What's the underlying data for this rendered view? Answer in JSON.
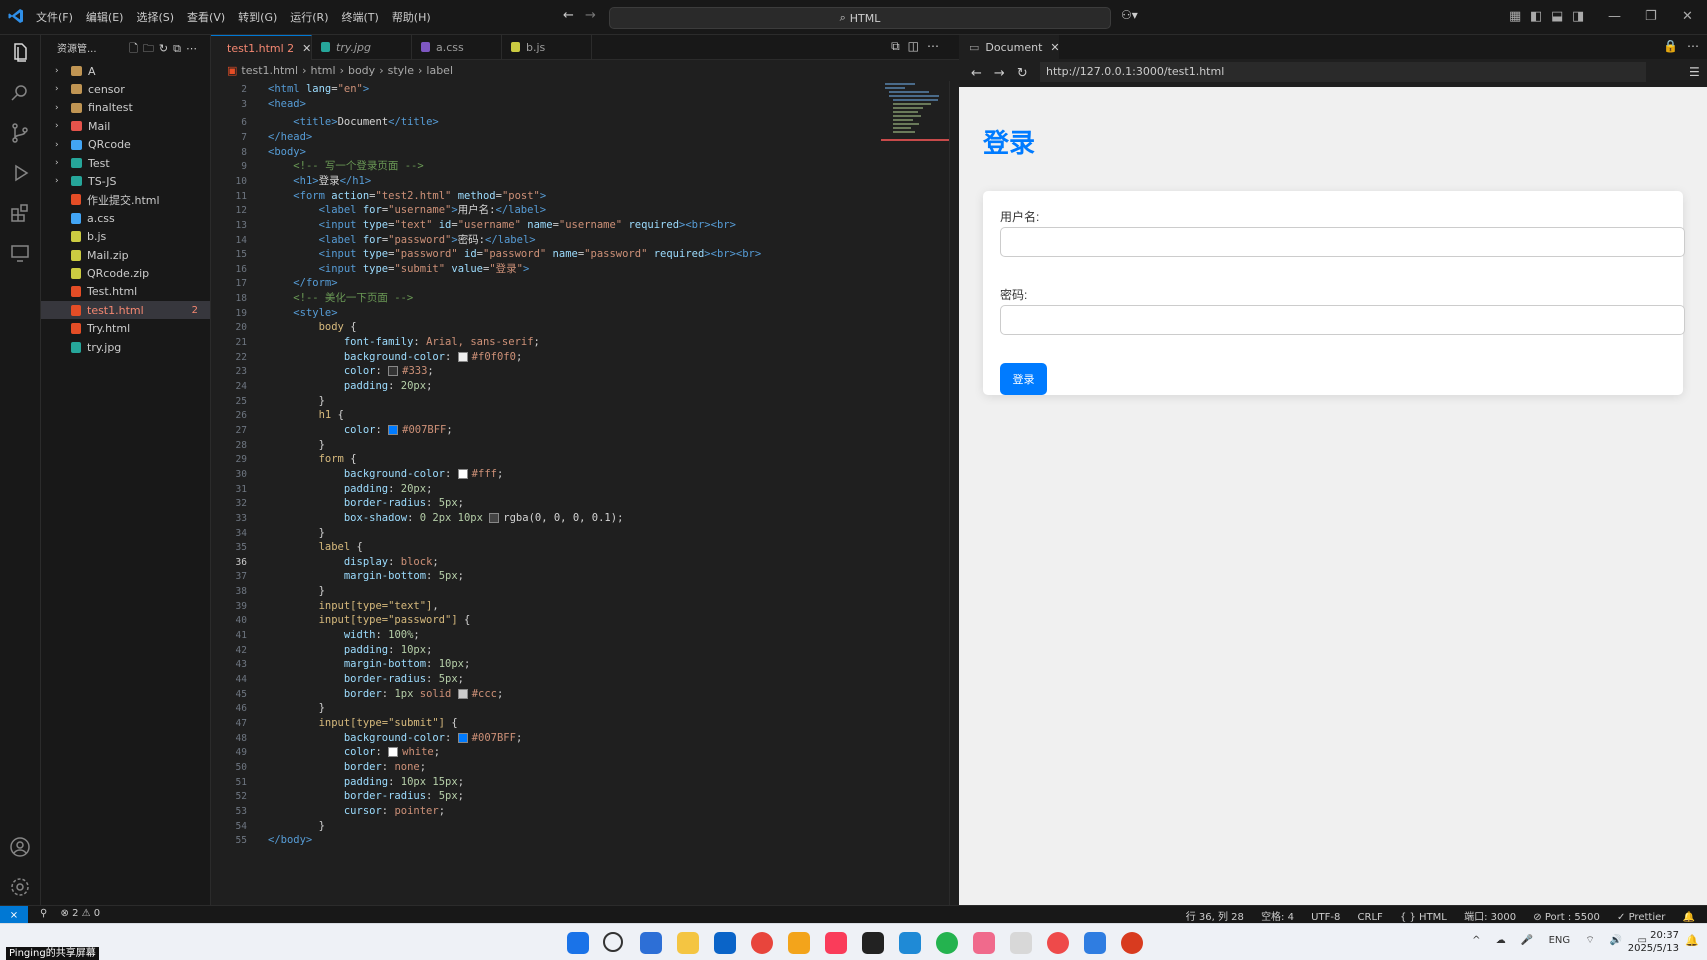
{
  "menu": [
    "文件(F)",
    "编辑(E)",
    "选择(S)",
    "查看(V)",
    "转到(G)",
    "运行(R)",
    "终端(T)",
    "帮助(H)"
  ],
  "command_center": "HTML",
  "explorer": {
    "title": "资源管...",
    "items": [
      {
        "label": "A",
        "type": "folder",
        "color": "#c09553"
      },
      {
        "label": "censor",
        "type": "folder",
        "color": "#c09553"
      },
      {
        "label": "finaltest",
        "type": "folder",
        "color": "#c09553"
      },
      {
        "label": "Mail",
        "type": "folder",
        "color": "#e5534b"
      },
      {
        "label": "QRcode",
        "type": "folder",
        "color": "#42a5f5"
      },
      {
        "label": "Test",
        "type": "folder",
        "color": "#26a69a"
      },
      {
        "label": "TS-JS",
        "type": "folder",
        "color": "#26a69a"
      },
      {
        "label": "作业提交.html",
        "type": "file",
        "color": "#e44d26"
      },
      {
        "label": "a.css",
        "type": "file",
        "color": "#42a5f5"
      },
      {
        "label": "b.js",
        "type": "file",
        "color": "#cbcb41"
      },
      {
        "label": "Mail.zip",
        "type": "file",
        "color": "#cbcb41"
      },
      {
        "label": "QRcode.zip",
        "type": "file",
        "color": "#cbcb41"
      },
      {
        "label": "Test.html",
        "type": "file",
        "color": "#e44d26"
      },
      {
        "label": "test1.html",
        "type": "file",
        "color": "#e44d26",
        "selected": true,
        "badge": "2"
      },
      {
        "label": "Try.html",
        "type": "file",
        "color": "#e44d26"
      },
      {
        "label": "try.jpg",
        "type": "file",
        "color": "#26a69a"
      }
    ]
  },
  "tabs": [
    {
      "label": "test1.html 2",
      "icon_color": "#e44d26",
      "active": true,
      "error": true
    },
    {
      "label": "try.jpg",
      "icon_color": "#26a69a"
    },
    {
      "label": "a.css",
      "icon_color": "#7e57c2"
    },
    {
      "label": "b.js",
      "icon_color": "#cbcb41"
    }
  ],
  "breadcrumb": [
    "test1.html",
    "html",
    "body",
    "style",
    "label"
  ],
  "code_lines": [
    {
      "n": "2",
      "h": "<span class=\"tg\">&lt;html</span> <span class=\"at\">lang</span>=<span class=\"sv\">\"en\"</span><span class=\"tg\">&gt;</span>"
    },
    {
      "n": "3",
      "h": "<span class=\"tg\">&lt;head&gt;</span>"
    },
    {
      "n": "6",
      "h": "    <span class=\"tg\">&lt;title&gt;</span><span class=\"tx\">Document</span><span class=\"tg\">&lt;/title&gt;</span>"
    },
    {
      "n": "7",
      "h": "<span class=\"tg\">&lt;/head&gt;</span>"
    },
    {
      "n": "8",
      "h": "<span class=\"tg\">&lt;body&gt;</span>"
    },
    {
      "n": "9",
      "h": "    <span class=\"cm\">&lt;!-- 写一个登录页面 --&gt;</span>"
    },
    {
      "n": "10",
      "h": "    <span class=\"tg\">&lt;h1&gt;</span><span class=\"tx\">登录</span><span class=\"tg\">&lt;/h1&gt;</span>"
    },
    {
      "n": "11",
      "h": "    <span class=\"tg\">&lt;form</span> <span class=\"at\">action</span>=<span class=\"sv\">\"test2.html\"</span> <span class=\"at\">method</span>=<span class=\"sv\">\"post\"</span><span class=\"tg\">&gt;</span>"
    },
    {
      "n": "12",
      "h": "        <span class=\"tg\">&lt;label</span> <span class=\"at\">for</span>=<span class=\"sv\">\"username\"</span><span class=\"tg\">&gt;</span><span class=\"tx\">用户名:</span><span class=\"tg\">&lt;/label&gt;</span>"
    },
    {
      "n": "13",
      "h": "        <span class=\"tg\">&lt;input</span> <span class=\"at\">type</span>=<span class=\"sv\">\"text\"</span> <span class=\"at\">id</span>=<span class=\"sv\">\"username\"</span> <span class=\"at\">name</span>=<span class=\"sv\">\"username\"</span> <span class=\"at\">required</span><span class=\"tg\">&gt;&lt;br&gt;&lt;br&gt;</span>"
    },
    {
      "n": "14",
      "h": "        <span class=\"tg\">&lt;label</span> <span class=\"at\">for</span>=<span class=\"sv\">\"password\"</span><span class=\"tg\">&gt;</span><span class=\"tx\">密码:</span><span class=\"tg\">&lt;/label&gt;</span>"
    },
    {
      "n": "15",
      "h": "        <span class=\"tg\">&lt;input</span> <span class=\"at\">type</span>=<span class=\"sv\">\"password\"</span> <span class=\"at\">id</span>=<span class=\"sv\">\"password\"</span> <span class=\"at\">name</span>=<span class=\"sv\">\"password\"</span> <span class=\"at\">required</span><span class=\"tg\">&gt;&lt;br&gt;&lt;br&gt;</span>"
    },
    {
      "n": "16",
      "h": "        <span class=\"tg\">&lt;input</span> <span class=\"at\">type</span>=<span class=\"sv\">\"submit\"</span> <span class=\"at\">value</span>=<span class=\"sv\">\"登录\"</span><span class=\"tg\">&gt;</span>"
    },
    {
      "n": "17",
      "h": "    <span class=\"tg\">&lt;/form&gt;</span>"
    },
    {
      "n": "18",
      "h": "    <span class=\"cm\">&lt;!-- 美化一下页面 --&gt;</span>"
    },
    {
      "n": "19",
      "h": "    <span class=\"tg\">&lt;style&gt;</span>"
    },
    {
      "n": "20",
      "h": "        <span class=\"sl\">body</span> <span class=\"pu\">{</span>"
    },
    {
      "n": "21",
      "h": "            <span class=\"pr\">font-family</span>: <span class=\"vl\">Arial, sans-serif</span>;"
    },
    {
      "n": "22",
      "h": "            <span class=\"pr\">background-color</span>: <span class=\"sw\" style=\"background:#f0f0f0\"></span><span class=\"vl\">#f0f0f0</span>;"
    },
    {
      "n": "23",
      "h": "            <span class=\"pr\">color</span>: <span class=\"sw\" style=\"background:#333333\"></span><span class=\"vl\">#333</span>;"
    },
    {
      "n": "24",
      "h": "            <span class=\"pr\">padding</span>: <span class=\"nm\">20px</span>;"
    },
    {
      "n": "25",
      "h": "        <span class=\"pu\">}</span>"
    },
    {
      "n": "26",
      "h": "        <span class=\"sl\">h1</span> <span class=\"pu\">{</span>"
    },
    {
      "n": "27",
      "h": "            <span class=\"pr\">color</span>: <span class=\"sw\" style=\"background:#007bff\"></span><span class=\"vl\">#007BFF</span>;"
    },
    {
      "n": "28",
      "h": "        <span class=\"pu\">}</span>"
    },
    {
      "n": "29",
      "h": "        <span class=\"sl\">form</span> <span class=\"pu\">{</span>"
    },
    {
      "n": "30",
      "h": "            <span class=\"pr\">background-color</span>: <span class=\"sw\" style=\"background:#ffffff\"></span><span class=\"vl\">#fff</span>;"
    },
    {
      "n": "31",
      "h": "            <span class=\"pr\">padding</span>: <span class=\"nm\">20px</span>;"
    },
    {
      "n": "32",
      "h": "            <span class=\"pr\">border-radius</span>: <span class=\"nm\">5px</span>;"
    },
    {
      "n": "33",
      "h": "            <span class=\"pr\">box-shadow</span>: <span class=\"nm\">0 2px 10px</span> <span class=\"sw\" style=\"background:#444444\"></span><span class=\"tx\">rgba(0, 0, 0, 0.1)</span>;"
    },
    {
      "n": "34",
      "h": "        <span class=\"pu\">}</span>"
    },
    {
      "n": "35",
      "h": "        <span class=\"sl\">label</span> <span class=\"pu\">{</span>"
    },
    {
      "n": "36",
      "h": "            <span class=\"pr\">display</span>: <span class=\"vl\">block</span>;",
      "cur": true
    },
    {
      "n": "37",
      "h": "            <span class=\"pr\">margin-bottom</span>: <span class=\"nm\">5px</span>;"
    },
    {
      "n": "38",
      "h": "        <span class=\"pu\">}</span>"
    },
    {
      "n": "39",
      "h": "        <span class=\"sl\">input[type=\"text\"]</span>,"
    },
    {
      "n": "40",
      "h": "        <span class=\"sl\">input[type=\"password\"]</span> <span class=\"pu\">{</span>"
    },
    {
      "n": "41",
      "h": "            <span class=\"pr\">width</span>: <span class=\"nm\">100%</span>;"
    },
    {
      "n": "42",
      "h": "            <span class=\"pr\">padding</span>: <span class=\"nm\">10px</span>;"
    },
    {
      "n": "43",
      "h": "            <span class=\"pr\">margin-bottom</span>: <span class=\"nm\">10px</span>;"
    },
    {
      "n": "44",
      "h": "            <span class=\"pr\">border-radius</span>: <span class=\"nm\">5px</span>;"
    },
    {
      "n": "45",
      "h": "            <span class=\"pr\">border</span>: <span class=\"nm\">1px</span> <span class=\"vl\">solid</span> <span class=\"sw\" style=\"background:#cccccc\"></span><span class=\"vl\">#ccc</span>;"
    },
    {
      "n": "46",
      "h": "        <span class=\"pu\">}</span>"
    },
    {
      "n": "47",
      "h": "        <span class=\"sl\">input[type=\"submit\"]</span> <span class=\"pu\">{</span>"
    },
    {
      "n": "48",
      "h": "            <span class=\"pr\">background-color</span>: <span class=\"sw\" style=\"background:#007bff\"></span><span class=\"vl\">#007BFF</span>;"
    },
    {
      "n": "49",
      "h": "            <span class=\"pr\">color</span>: <span class=\"sw\" style=\"background:#ffffff\"></span><span class=\"vl\">white</span>;"
    },
    {
      "n": "50",
      "h": "            <span class=\"pr\">border</span>: <span class=\"vl\">none</span>;"
    },
    {
      "n": "51",
      "h": "            <span class=\"pr\">padding</span>: <span class=\"nm\">10px 15px</span>;"
    },
    {
      "n": "52",
      "h": "            <span class=\"pr\">border-radius</span>: <span class=\"nm\">5px</span>;"
    },
    {
      "n": "53",
      "h": "            <span class=\"pr\">cursor</span>: <span class=\"vl\">pointer</span>;"
    },
    {
      "n": "54",
      "h": "        <span class=\"pu\">}</span>"
    },
    {
      "n": "55",
      "h": "<span class=\"tg\">&lt;/body&gt;</span>"
    }
  ],
  "browser": {
    "tab_title": "Document",
    "url": "http://127.0.0.1:3000/test1.html",
    "page": {
      "heading": "登录",
      "username_label": "用户名:",
      "password_label": "密码:",
      "submit_label": "登录"
    }
  },
  "status_bar": {
    "problems": "⊗ 2 ⚠ 0",
    "position": "行 36, 列 28",
    "spaces": "空格: 4",
    "encoding": "UTF-8",
    "eol": "CRLF",
    "language": "{ } HTML",
    "port": "端口: 3000",
    "live_port": "⊘ Port : 5500",
    "prettier": "✓ Prettier"
  },
  "taskbar": {
    "tray": [
      "^",
      "ENG"
    ],
    "time": "20:37",
    "date": "2025/5/13",
    "share_label": "Pinging的共享屏幕"
  },
  "colors": {
    "accent": "#0078d4",
    "page_heading": "#007bff",
    "error": "#f48771"
  }
}
